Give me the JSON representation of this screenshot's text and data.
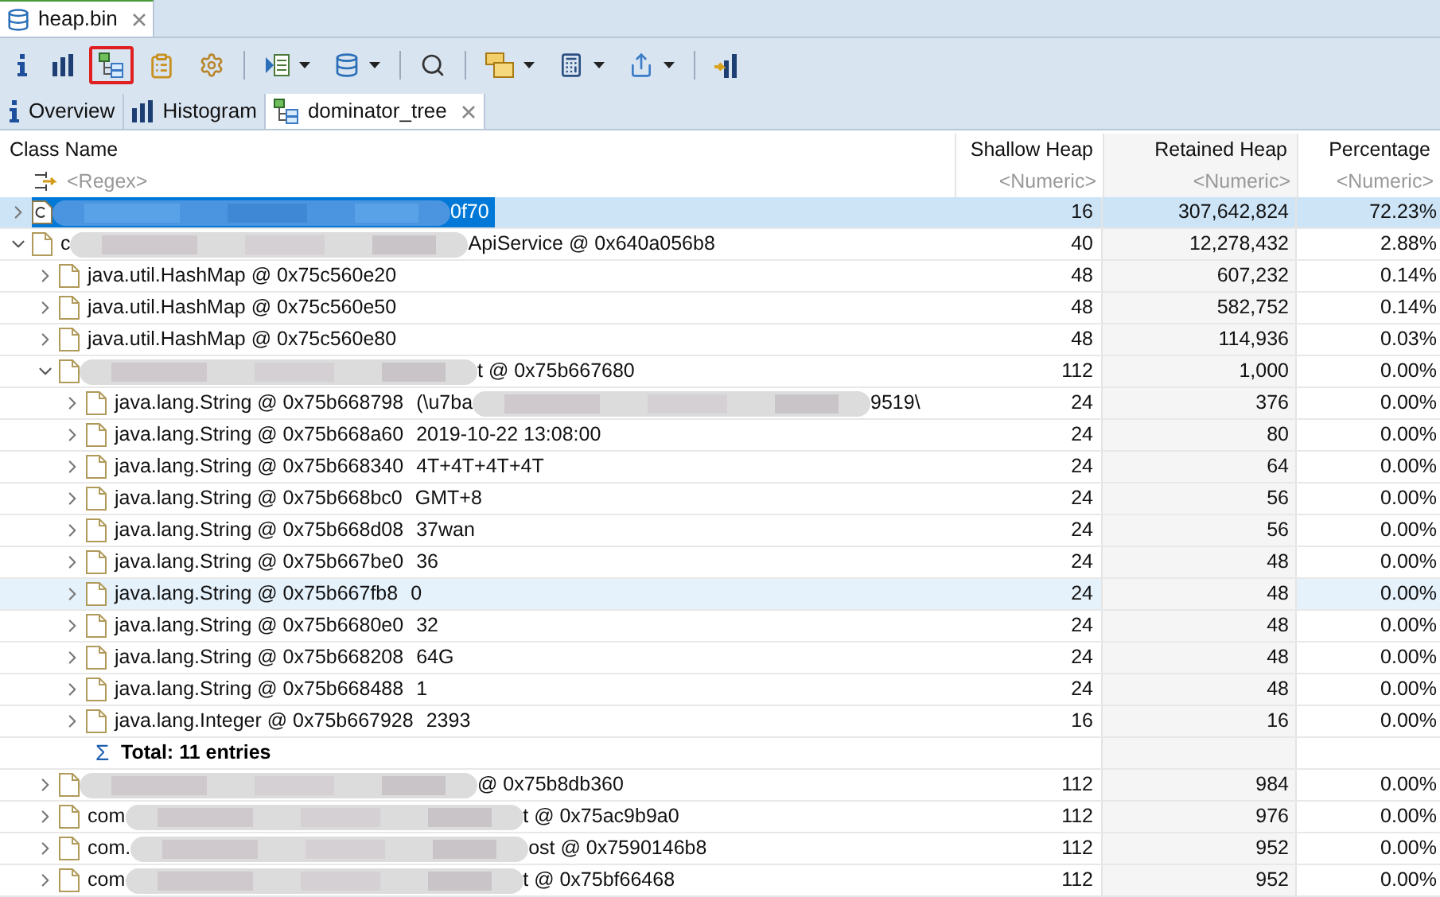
{
  "editor_tab": {
    "title": "heap.bin"
  },
  "toolbar": [
    {
      "kind": "info",
      "dropdown": false,
      "selected": false
    },
    {
      "kind": "histogram",
      "dropdown": false,
      "selected": false
    },
    {
      "kind": "tree",
      "dropdown": false,
      "selected": true
    },
    {
      "kind": "clipboard",
      "dropdown": false,
      "selected": false
    },
    {
      "kind": "gear",
      "dropdown": false,
      "selected": false
    },
    {
      "kind": "separator"
    },
    {
      "kind": "query",
      "dropdown": true,
      "selected": false
    },
    {
      "kind": "database",
      "dropdown": true,
      "selected": false
    },
    {
      "kind": "separator"
    },
    {
      "kind": "search",
      "dropdown": false,
      "selected": false
    },
    {
      "kind": "separator"
    },
    {
      "kind": "group",
      "dropdown": true,
      "selected": false
    },
    {
      "kind": "calculator",
      "dropdown": true,
      "selected": false
    },
    {
      "kind": "export",
      "dropdown": true,
      "selected": false
    },
    {
      "kind": "separator"
    },
    {
      "kind": "bars",
      "dropdown": false,
      "selected": false
    }
  ],
  "view_tabs": [
    {
      "label": "Overview",
      "kind": "info",
      "selected": false,
      "closable": false
    },
    {
      "label": "Histogram",
      "kind": "histogram",
      "selected": false,
      "closable": false
    },
    {
      "label": "dominator_tree",
      "kind": "tree",
      "selected": true,
      "closable": true
    }
  ],
  "table": {
    "columns": [
      "Class Name",
      "Shallow Heap",
      "Retained Heap",
      "Percentage"
    ],
    "filters": [
      "<Regex>",
      "<Numeric>",
      "<Numeric>",
      "<Numeric>"
    ],
    "rows": [
      {
        "kind": "class",
        "expanded": false,
        "selected": true,
        "hovered": false,
        "redacted": true,
        "suffix": "0f70",
        "shallow": "16",
        "retained": "307,642,824",
        "percentage": "72.23%"
      },
      {
        "kind": "object",
        "expanded": true,
        "selected": false,
        "hovered": false,
        "label": "c",
        "redacted": true,
        "suffix": "ApiService @ 0x640a056b8",
        "shallow": "40",
        "retained": "12,278,432",
        "percentage": "2.88%",
        "children": [
          {
            "kind": "object",
            "expanded": false,
            "selected": false,
            "hovered": false,
            "label": "java.util.HashMap @ 0x75c560e20",
            "redacted": false,
            "shallow": "48",
            "retained": "607,232",
            "percentage": "0.14%"
          },
          {
            "kind": "object",
            "expanded": false,
            "selected": false,
            "hovered": false,
            "label": "java.util.HashMap @ 0x75c560e50",
            "redacted": false,
            "shallow": "48",
            "retained": "582,752",
            "percentage": "0.14%"
          },
          {
            "kind": "object",
            "expanded": false,
            "selected": false,
            "hovered": false,
            "label": "java.util.HashMap @ 0x75c560e80",
            "redacted": false,
            "shallow": "48",
            "retained": "114,936",
            "percentage": "0.03%"
          },
          {
            "kind": "object",
            "expanded": true,
            "selected": false,
            "hovered": false,
            "redacted": true,
            "suffix": "t @ 0x75b667680",
            "shallow": "112",
            "retained": "1,000",
            "percentage": "0.00%",
            "children": [
              {
                "kind": "object",
                "expanded": false,
                "selected": false,
                "hovered": false,
                "label": "java.lang.String @ 0x75b668798",
                "value": "(\\u7ba",
                "redacted": true,
                "suffix": "9519\\",
                "shallow": "24",
                "retained": "376",
                "percentage": "0.00%"
              },
              {
                "kind": "object",
                "expanded": false,
                "selected": false,
                "hovered": false,
                "label": "java.lang.String @ 0x75b668a60",
                "value": "2019-10-22 13:08:00",
                "redacted": false,
                "shallow": "24",
                "retained": "80",
                "percentage": "0.00%"
              },
              {
                "kind": "object",
                "expanded": false,
                "selected": false,
                "hovered": false,
                "label": "java.lang.String @ 0x75b668340",
                "value": "4T+4T+4T+4T",
                "redacted": false,
                "shallow": "24",
                "retained": "64",
                "percentage": "0.00%"
              },
              {
                "kind": "object",
                "expanded": false,
                "selected": false,
                "hovered": false,
                "label": "java.lang.String @ 0x75b668bc0",
                "value": "GMT+8",
                "redacted": false,
                "shallow": "24",
                "retained": "56",
                "percentage": "0.00%"
              },
              {
                "kind": "object",
                "expanded": false,
                "selected": false,
                "hovered": false,
                "label": "java.lang.String @ 0x75b668d08",
                "value": "37wan",
                "redacted": false,
                "shallow": "24",
                "retained": "56",
                "percentage": "0.00%"
              },
              {
                "kind": "object",
                "expanded": false,
                "selected": false,
                "hovered": false,
                "label": "java.lang.String @ 0x75b667be0",
                "value": "36",
                "redacted": false,
                "shallow": "24",
                "retained": "48",
                "percentage": "0.00%"
              },
              {
                "kind": "object",
                "expanded": false,
                "selected": false,
                "hovered": true,
                "label": "java.lang.String @ 0x75b667fb8",
                "value": "0",
                "redacted": false,
                "shallow": "24",
                "retained": "48",
                "percentage": "0.00%"
              },
              {
                "kind": "object",
                "expanded": false,
                "selected": false,
                "hovered": false,
                "label": "java.lang.String @ 0x75b6680e0",
                "value": "32",
                "redacted": false,
                "shallow": "24",
                "retained": "48",
                "percentage": "0.00%"
              },
              {
                "kind": "object",
                "expanded": false,
                "selected": false,
                "hovered": false,
                "label": "java.lang.String @ 0x75b668208",
                "value": "64G",
                "redacted": false,
                "shallow": "24",
                "retained": "48",
                "percentage": "0.00%"
              },
              {
                "kind": "object",
                "expanded": false,
                "selected": false,
                "hovered": false,
                "label": "java.lang.String @ 0x75b668488",
                "value": "1",
                "redacted": false,
                "shallow": "24",
                "retained": "48",
                "percentage": "0.00%"
              },
              {
                "kind": "object",
                "expanded": false,
                "selected": false,
                "hovered": false,
                "label": "java.lang.Integer @ 0x75b667928",
                "value": "2393",
                "redacted": false,
                "shallow": "16",
                "retained": "16",
                "percentage": "0.00%"
              },
              {
                "kind": "total",
                "selected": false,
                "hovered": false,
                "symbol": "Σ",
                "label": "Total: 11 entries"
              }
            ]
          },
          {
            "kind": "object",
            "expanded": false,
            "selected": false,
            "hovered": false,
            "redacted": true,
            "suffix": "@ 0x75b8db360",
            "shallow": "112",
            "retained": "984",
            "percentage": "0.00%"
          },
          {
            "kind": "object",
            "expanded": false,
            "selected": false,
            "hovered": false,
            "label": "com",
            "redacted": true,
            "suffix": "t @ 0x75ac9b9a0",
            "shallow": "112",
            "retained": "976",
            "percentage": "0.00%"
          },
          {
            "kind": "object",
            "expanded": false,
            "selected": false,
            "hovered": false,
            "label": "com.",
            "redacted": true,
            "suffix": "ost @ 0x7590146b8",
            "shallow": "112",
            "retained": "952",
            "percentage": "0.00%"
          },
          {
            "kind": "object",
            "expanded": false,
            "selected": false,
            "hovered": false,
            "label": "com",
            "redacted": true,
            "suffix": "t @ 0x75bf66468",
            "shallow": "112",
            "retained": "952",
            "percentage": "0.00%"
          }
        ]
      }
    ]
  }
}
